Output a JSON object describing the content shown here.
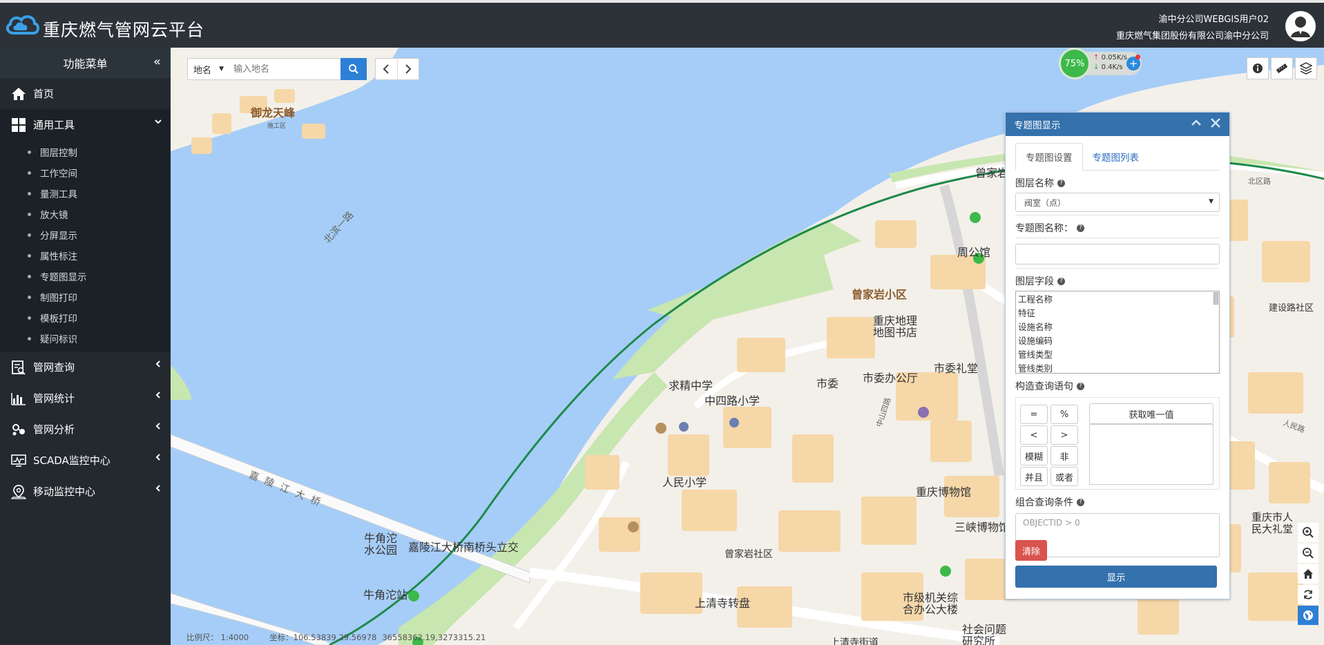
{
  "app": {
    "title": "重庆燃气管网云平台",
    "user_name": "渝中分公司WEBGIS用户02",
    "user_org": "重庆燃气集团股份有限公司渝中分公司"
  },
  "sidebar": {
    "heading": "功能菜单",
    "collapse_glyph": "«",
    "items": [
      {
        "label": "首页",
        "icon": "home-icon"
      },
      {
        "label": "通用工具",
        "icon": "grid-icon",
        "expanded": true,
        "children": [
          "图层控制",
          "工作空间",
          "量测工具",
          "放大镜",
          "分屏显示",
          "属性标注",
          "专题图显示",
          "制图打印",
          "模板打印",
          "疑问标识"
        ]
      },
      {
        "label": "管网查询",
        "icon": "query-icon"
      },
      {
        "label": "管网统计",
        "icon": "bar-chart-icon"
      },
      {
        "label": "管网分析",
        "icon": "analysis-icon"
      },
      {
        "label": "SCADA监控中心",
        "icon": "monitor-icon"
      },
      {
        "label": "移动监控中心",
        "icon": "location-icon"
      }
    ]
  },
  "map": {
    "search_type": "地名",
    "search_placeholder": "输入地名",
    "network": {
      "percent": "75%",
      "up": "0.05K/s",
      "down": "0.4K/s"
    },
    "status": {
      "scale": "比例尺：   1:4000",
      "coords": "坐标：106.53839,29.56978",
      "proj": "36558362.19,3273315.21"
    },
    "labels": [
      "御龙天峰",
      "施工区",
      "周公馆",
      "曾家岩小区",
      "重庆地理\n地图书店",
      "市委",
      "市委办公厅",
      "市委礼堂",
      "求精中学",
      "中四路小学",
      "人民小学",
      "重庆博物馆",
      "三峡博物馆",
      "牛角沱\n水公园",
      "牛角沱站",
      "嘉陵江大桥南桥头立交",
      "上清寺转盘",
      "曾家岩社区",
      "市级机关综\n合办公大楼",
      "社会问题\n研究所",
      "建设路社区",
      "重庆市人\n民大礼堂",
      "上清寺街道",
      "曾家岩",
      "北滨一路",
      "嘉陵江大桥",
      "中山四路",
      "人民路",
      "北区路"
    ]
  },
  "panel": {
    "title": "专题图显示",
    "tabs": [
      "专题图设置",
      "专题图列表"
    ],
    "layer_name_label": "图层名称",
    "layer_value": "阀室（点）",
    "theme_name_label": "专题图名称：",
    "layer_field_label": "图层字段",
    "fields": [
      "工程名称",
      "特征",
      "设施名称",
      "设施编码",
      "管线类型",
      "管线类别"
    ],
    "query_builder_label": "构造查询语句",
    "operators": [
      "=",
      "%",
      "<",
      ">",
      "模糊",
      "非",
      "并且",
      "或者"
    ],
    "unique_btn": "获取唯一值",
    "combo_label": "组合查询条件",
    "combo_placeholder": "OBJECTID > 0",
    "clear_btn": "清除",
    "show_btn": "显示"
  },
  "colors": {
    "header": "#2c3238",
    "sidebar": "#23292f",
    "panel_title": "#3471ad",
    "water": "#a6cdf7",
    "green": "#3cb94a",
    "danger": "#d9534f"
  }
}
